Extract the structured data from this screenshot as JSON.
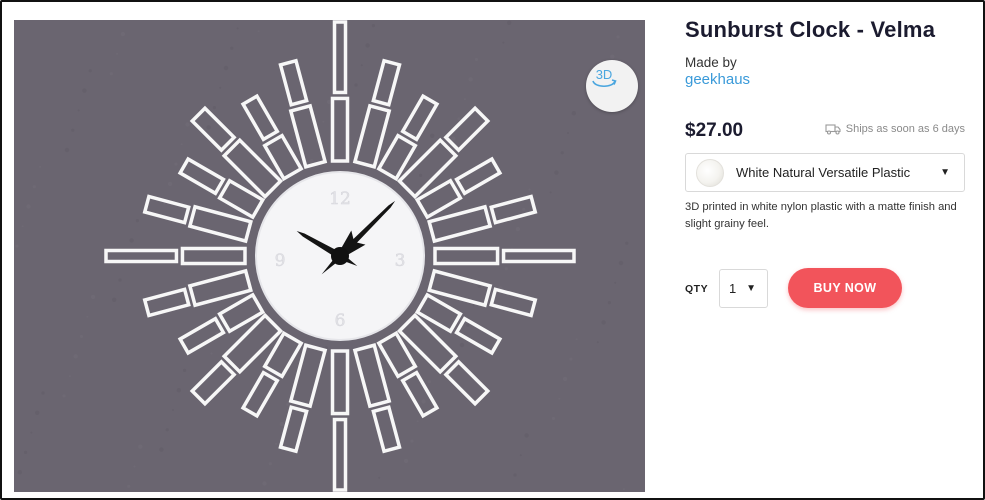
{
  "product": {
    "title": "Sunburst Clock - Velma",
    "made_by_label": "Made by",
    "maker": "geekhaus",
    "price": "$27.00",
    "shipping": "Ships as soon as 6 days",
    "material": "White Natural Versatile Plastic",
    "description": "3D printed in white nylon plastic with a matte finish and slight grainy feel.",
    "qty_label": "QTY",
    "qty_value": "1",
    "buy_label": "BUY NOW"
  },
  "viewer": {
    "badge_label": "3D"
  },
  "clock": {
    "numerals": [
      "12",
      "3",
      "6",
      "9"
    ],
    "hour_hand_angle_deg": 300,
    "minute_hand_angle_deg": 45
  },
  "colors": {
    "accent": "#f2545b",
    "link": "#3a9ad9",
    "photo_bg": "#6b6670"
  },
  "icons": {
    "three_d": "3d-rotate-icon",
    "truck": "truck-icon",
    "dropdown": "caret-down-icon"
  }
}
